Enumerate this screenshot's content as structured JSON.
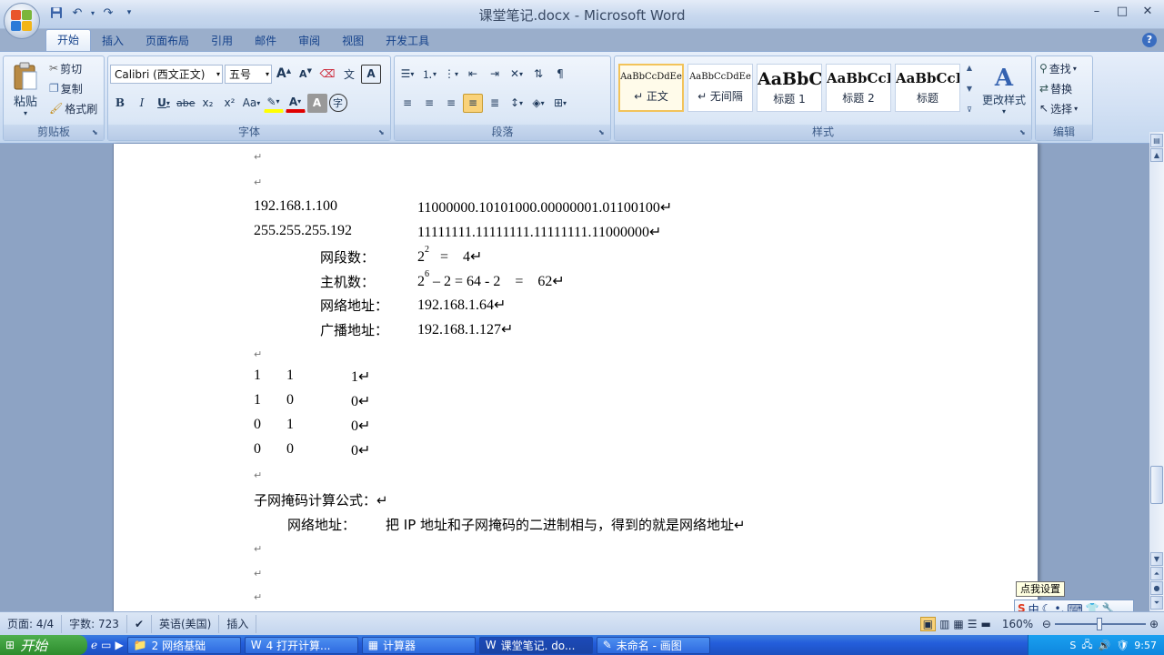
{
  "window": {
    "title": "课堂笔记.docx - Microsoft Word",
    "controls": [
      "–",
      "□",
      "✕"
    ]
  },
  "qat": {
    "save_icon": "save-icon",
    "undo_icon": "undo-icon",
    "redo_icon": "redo-icon",
    "more": "▾"
  },
  "tabs": [
    "开始",
    "插入",
    "页面布局",
    "引用",
    "邮件",
    "审阅",
    "视图",
    "开发工具"
  ],
  "help": "?",
  "clipboard": {
    "paste": "粘贴",
    "cut": "剪切",
    "copy": "复制",
    "format_painter": "格式刷",
    "label": "剪贴板"
  },
  "font": {
    "name": "Calibri (西文正文)",
    "size": "五号",
    "bold": "B",
    "italic": "I",
    "underline": "U",
    "strike": "abe",
    "subscript": "x₂",
    "superscript": "x²",
    "change_case": "Aa",
    "highlight": "ab⁄",
    "font_color": "A",
    "char_shading": "A",
    "enclose": "字",
    "grow": "A",
    "shrink": "A",
    "pinyin": "文",
    "border": "A",
    "label": "字体"
  },
  "paragraph": {
    "label": "段落"
  },
  "styles": {
    "tiles": [
      {
        "preview": "AaBbCcDdEe",
        "name": "↵ 正文"
      },
      {
        "preview": "AaBbCcDdEe",
        "name": "↵ 无间隔"
      },
      {
        "preview": "AaBbC",
        "name": "标题 1"
      },
      {
        "preview": "AaBbCcI",
        "name": "标题 2"
      },
      {
        "preview": "AaBbCcI",
        "name": "标题"
      }
    ],
    "change": "更改样式",
    "label": "样式"
  },
  "editing": {
    "find": "查找",
    "replace": "替换",
    "select": "选择",
    "label": "编辑"
  },
  "document": {
    "lines": [
      {
        "a": "↵"
      },
      {
        "a": "↵"
      },
      {
        "a": "192.168.1.100",
        "b": "11000000.10101000.00000001.01100100↵"
      },
      {
        "a": "255.255.255.192",
        "b": "11111111.11111111.11111111.11000000↵"
      },
      {
        "label": "网段数：",
        "b_base": "2",
        "b_sup": "2",
        "b_rest": "   =    4↵"
      },
      {
        "label": "主机数：",
        "b_base": "2",
        "b_sup": "6",
        "b_rest": " – 2 = 64 - 2    =    62↵"
      },
      {
        "label": "网络地址：",
        "b": "192.168.1.64↵"
      },
      {
        "label": "广播地址：",
        "b": "192.168.1.127↵"
      },
      {
        "a": "↵"
      },
      {
        "c1": "1",
        "c2": "1",
        "c3": "1↵"
      },
      {
        "c1": "1",
        "c2": "0",
        "c3": "0↵"
      },
      {
        "c1": "0",
        "c2": "1",
        "c3": "0↵"
      },
      {
        "c1": "0",
        "c2": "0",
        "c3": "0↵"
      },
      {
        "a": "↵"
      },
      {
        "a": "子网掩码计算公式：↵"
      },
      {
        "label": "网络地址：",
        "b": "把 IP 地址和子网掩码的二进制相与，得到的就是网络地址↵"
      },
      {
        "a": "↵"
      },
      {
        "a": "↵"
      },
      {
        "a": "↵"
      }
    ]
  },
  "status": {
    "page": "页面: 4/4",
    "words": "字数: 723",
    "language": "英语(美国)",
    "mode": "插入",
    "zoom": "160%"
  },
  "ime": {
    "tooltip": "点我设置",
    "mode": "中"
  },
  "taskbar": {
    "start": "开始",
    "items": [
      {
        "label": "2 网络基础",
        "active": false
      },
      {
        "label": "4 打开计算...",
        "active": false
      },
      {
        "label": "计算器",
        "active": false
      },
      {
        "label": "课堂笔记. do...",
        "active": true
      },
      {
        "label": "未命名 - 画图",
        "active": false
      }
    ],
    "clock": "9:57"
  }
}
